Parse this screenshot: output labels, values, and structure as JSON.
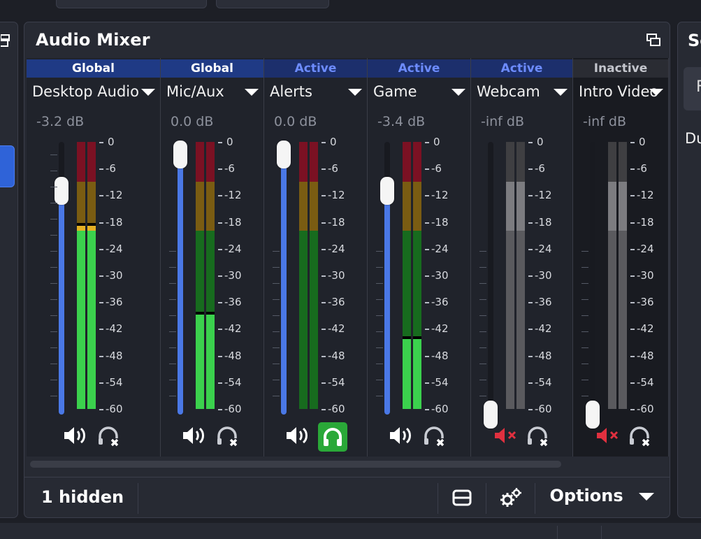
{
  "dock": {
    "title": "Audio Mixer",
    "hidden_label": "1 hidden",
    "options_label": "Options",
    "undock_icon": "undock-icon",
    "layout_icon": "horizontal-layout-icon",
    "advanced_icon": "gears-icon"
  },
  "scale_labels": [
    "0",
    "-6",
    "-12",
    "-18",
    "-24",
    "-30",
    "-36",
    "-42",
    "-48",
    "-54",
    "-60"
  ],
  "channels": [
    {
      "badge": "Global",
      "badge_type": "global",
      "name": "Desktop Audio",
      "db": "-3.2 dB",
      "volume_fraction": 0.82,
      "muted": false,
      "monitoring": false,
      "meter_level_db": -18.5,
      "inactive": false
    },
    {
      "badge": "Global",
      "badge_type": "global",
      "name": "Mic/Aux",
      "db": "0.0 dB",
      "volume_fraction": 1.0,
      "muted": false,
      "monitoring": false,
      "meter_level_db": -38.5,
      "inactive": false
    },
    {
      "badge": "Active",
      "badge_type": "active",
      "name": "Alerts",
      "db": "0.0 dB",
      "volume_fraction": 1.0,
      "muted": false,
      "monitoring": true,
      "meter_level_db": null,
      "inactive": false
    },
    {
      "badge": "Active",
      "badge_type": "active",
      "name": "Game",
      "db": "-3.4 dB",
      "volume_fraction": 0.82,
      "muted": false,
      "monitoring": false,
      "meter_level_db": -44.0,
      "inactive": false
    },
    {
      "badge": "Active",
      "badge_type": "active",
      "name": "Webcam",
      "db": "-inf dB",
      "volume_fraction": 0.0,
      "muted": true,
      "monitoring": false,
      "meter_level_db": null,
      "inactive": false
    },
    {
      "badge": "Inactive",
      "badge_type": "inactive",
      "name": "Intro Video",
      "db": "-inf dB",
      "volume_fraction": 0.0,
      "muted": true,
      "monitoring": false,
      "meter_level_db": null,
      "inactive": true
    }
  ],
  "side_panel": {
    "title_partial": "Sc",
    "text_partial": "Du",
    "button_partial": "F"
  },
  "colors": {
    "accent": "#4a78e6",
    "meter_green": "#3bd14d",
    "meter_yellow": "#e5b024",
    "meter_red": "#d4243f",
    "monitor_on": "#2aa838",
    "mute_red": "#e0303f"
  }
}
